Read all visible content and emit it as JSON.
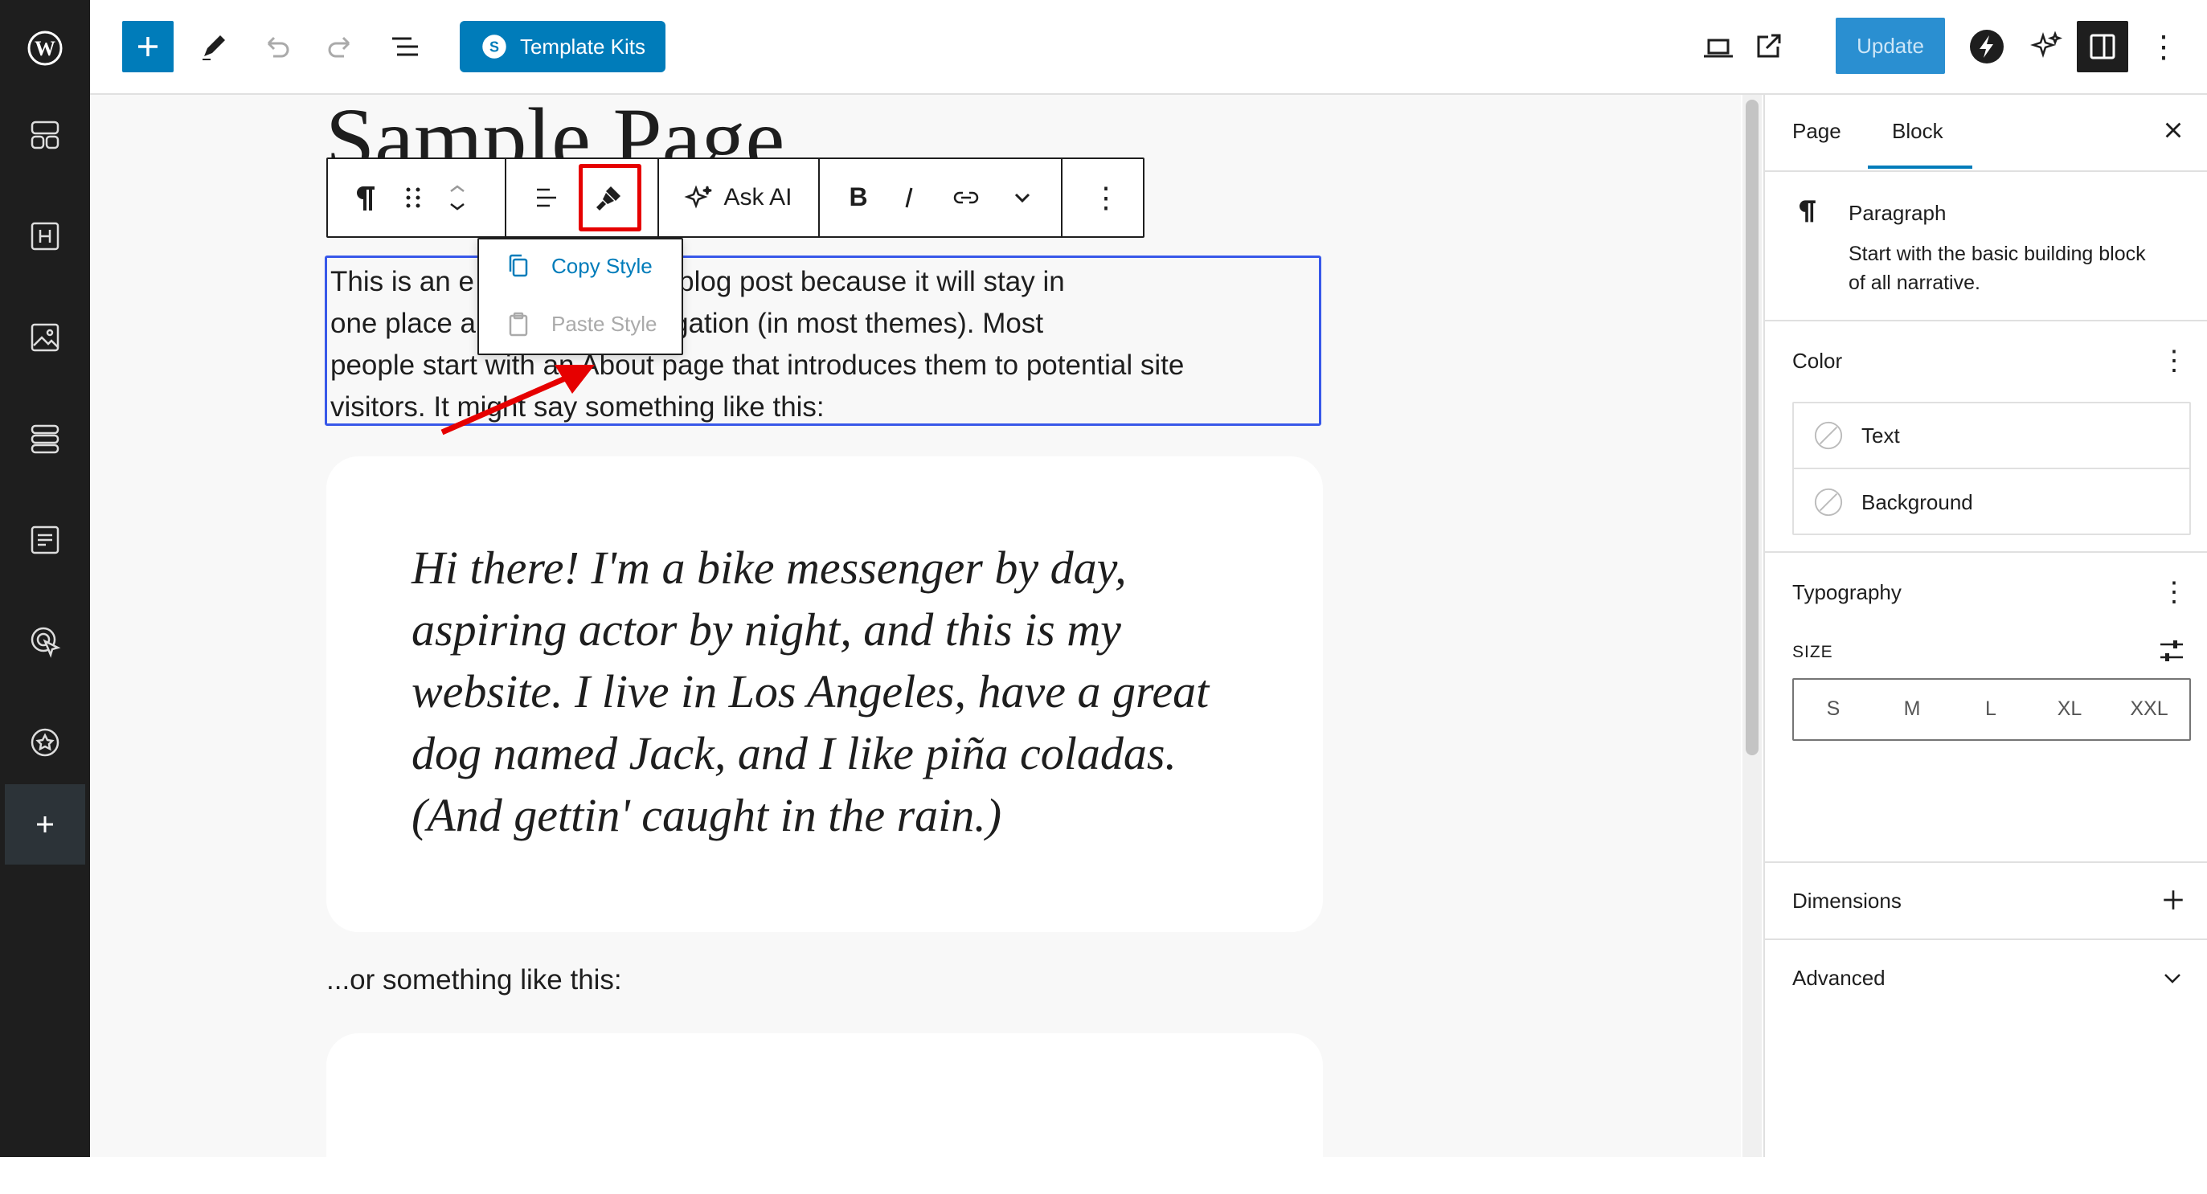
{
  "colors": {
    "accent": "#007cba",
    "dark": "#1e1e1e",
    "highlight": "#e60000",
    "spell": "#d63638"
  },
  "left_sidebar": {
    "items": [
      {
        "icon": "wordpress-logo-icon"
      },
      {
        "icon": "templates-icon"
      },
      {
        "icon": "header-icon"
      },
      {
        "icon": "media-icon"
      },
      {
        "icon": "patterns-icon"
      },
      {
        "icon": "forms-icon"
      },
      {
        "icon": "cursor-icon"
      },
      {
        "icon": "star-badge-icon"
      },
      {
        "icon": "add-icon"
      }
    ]
  },
  "toolbar": {
    "template_kits_label": "Template Kits",
    "update_label": "Update"
  },
  "editor": {
    "page_title": "Sample Page",
    "block_toolbar": {
      "ask_ai_label": "Ask AI"
    },
    "popover": {
      "copy_style": "Copy Style",
      "paste_style": "Paste Style"
    },
    "paragraph_lines": [
      "This is an e          different from a blog post because it will stay in",
      "one place a           n your site navigation (in most themes). Most",
      "people start with an About page that introduces them to potential site",
      "visitors. It might say something like this:"
    ],
    "quote_lines": [
      "Hi there! I'm a bike messenger by day,",
      "aspiring actor by night, and this is my",
      "website. I live in Los Angeles, have a great",
      "dog named Jack, and I like piña coladas.",
      "(And gettin' caught in the rain.)"
    ],
    "or_text": "...or something like this:"
  },
  "panel": {
    "tabs": [
      "Page",
      "Block"
    ],
    "active_tab": "Block",
    "block_name": "Paragraph",
    "block_description": [
      "Start with the basic building block",
      "of all narrative."
    ],
    "color_title": "Color",
    "color_items": [
      "Text",
      "Background"
    ],
    "typography_title": "Typography",
    "size_label": "SIZE",
    "size_options": [
      "S",
      "M",
      "L",
      "XL",
      "XXL"
    ],
    "dimensions_title": "Dimensions",
    "advanced_title": "Advanced"
  }
}
